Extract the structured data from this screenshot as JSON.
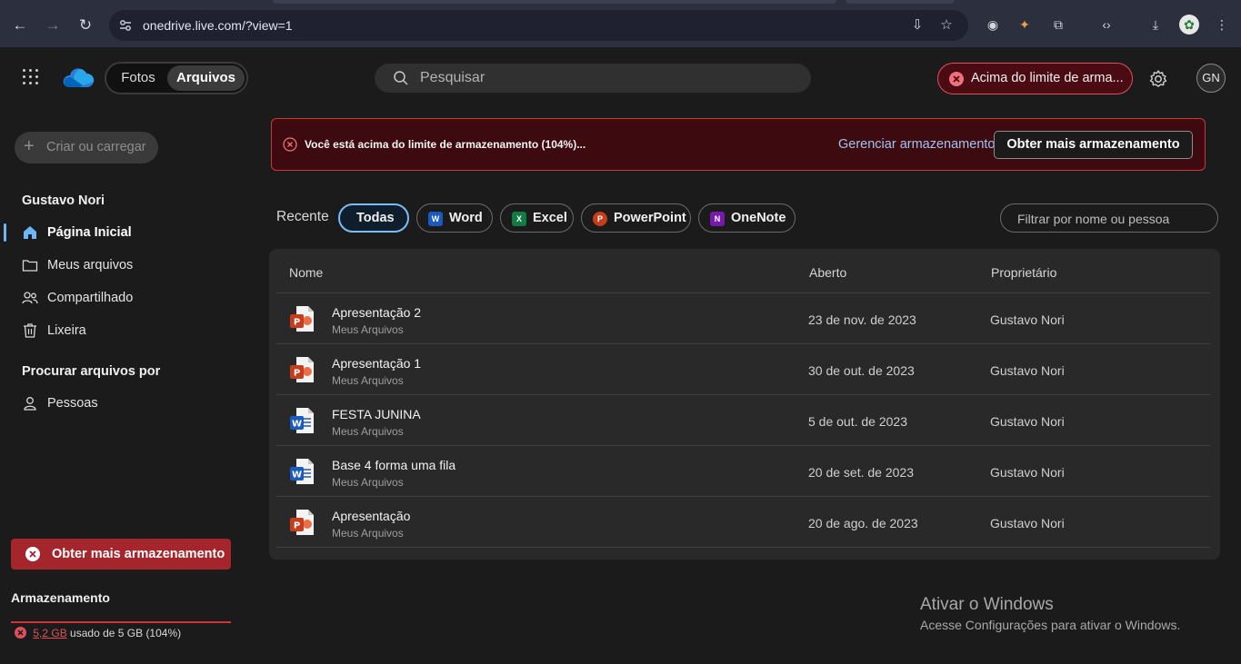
{
  "browser": {
    "url": "onedrive.live.com/?view=1"
  },
  "header": {
    "switch_photos": "Fotos",
    "switch_files": "Arquivos",
    "search_placeholder": "Pesquisar",
    "storage_alert": "Acima do limite de arma...",
    "avatar_initials": "GN"
  },
  "sidebar": {
    "create_label": "Criar ou carregar",
    "user_name": "Gustavo Nori",
    "nav": [
      {
        "label": "Página Inicial",
        "icon": "home-icon",
        "active": true
      },
      {
        "label": "Meus arquivos",
        "icon": "folder-icon",
        "active": false
      },
      {
        "label": "Compartilhado",
        "icon": "people-icon",
        "active": false
      },
      {
        "label": "Lixeira",
        "icon": "trash-icon",
        "active": false
      }
    ],
    "browse_heading": "Procurar arquivos por",
    "browse_people": "Pessoas",
    "get_more_label": "Obter mais armazenamento",
    "storage_title": "Armazenamento",
    "storage_used": "5,2 GB",
    "storage_rest": "usado de 5 GB (104%)",
    "storage_fraction": 1.04
  },
  "banner": {
    "message": "Você está acima do limite de armazenamento (104%)...",
    "manage_link": "Gerenciar armazenamento",
    "cta": "Obter mais armazenamento"
  },
  "filters": {
    "recent_label": "Recente",
    "chips": [
      {
        "label": "Todas",
        "active": true
      },
      {
        "label": "Word",
        "icon": "word-icon",
        "color": "#185abd"
      },
      {
        "label": "Excel",
        "icon": "excel-icon",
        "color": "#107c41"
      },
      {
        "label": "PowerPoint",
        "icon": "powerpoint-icon",
        "color": "#c43e1c"
      },
      {
        "label": "OneNote",
        "icon": "onenote-icon",
        "color": "#7719aa"
      }
    ],
    "filter_placeholder": "Filtrar por nome ou pessoa"
  },
  "table": {
    "headers": {
      "name": "Nome",
      "opened": "Aberto",
      "owner": "Proprietário"
    },
    "rows": [
      {
        "name": "Apresentação 2",
        "location": "Meus Arquivos",
        "opened": "23 de nov. de 2023",
        "owner": "Gustavo Nori",
        "type": "powerpoint"
      },
      {
        "name": "Apresentação 1",
        "location": "Meus Arquivos",
        "opened": "30 de out. de 2023",
        "owner": "Gustavo Nori",
        "type": "powerpoint"
      },
      {
        "name": "FESTA JUNINA",
        "location": "Meus Arquivos",
        "opened": "5 de out. de 2023",
        "owner": "Gustavo Nori",
        "type": "word"
      },
      {
        "name": "Base 4 forma uma fila",
        "location": "Meus Arquivos",
        "opened": "20 de set. de 2023",
        "owner": "Gustavo Nori",
        "type": "word"
      },
      {
        "name": "Apresentação",
        "location": "Meus Arquivos",
        "opened": "20 de ago. de 2023",
        "owner": "Gustavo Nori",
        "type": "powerpoint"
      }
    ]
  },
  "watermark": {
    "title": "Ativar o Windows",
    "subtitle": "Acesse Configurações para ativar o Windows."
  },
  "colors": {
    "accent": "#6cb8f6",
    "danger": "#d13438",
    "word": "#185abd",
    "powerpoint": "#c43e1c"
  }
}
